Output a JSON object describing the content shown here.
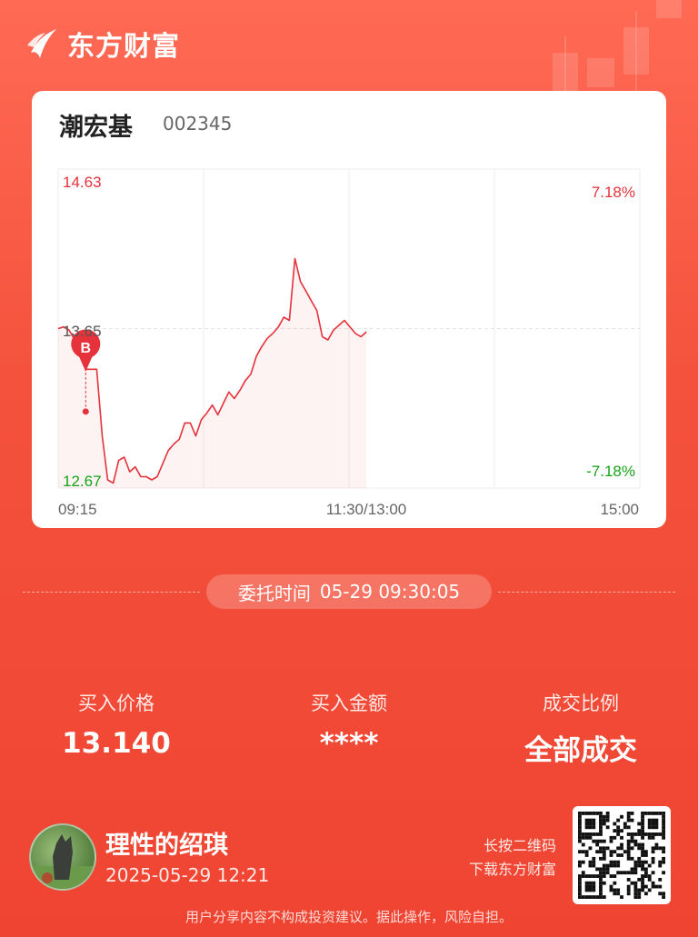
{
  "brand": {
    "name": "东方财富"
  },
  "stock": {
    "name": "潮宏基",
    "code": "002345"
  },
  "chart_data": {
    "type": "line",
    "price_high": "14.63",
    "price_mid": "13.65",
    "price_low": "12.67",
    "pct_high": "7.18%",
    "pct_low": "-7.18%",
    "ylim": [
      12.67,
      14.63
    ],
    "x_ticks": [
      "09:15",
      "11:30/13:00",
      "15:00"
    ],
    "buy_marker": "B",
    "series": [
      {
        "values": [
          13.65,
          13.66,
          13.64,
          13.58,
          13.48,
          13.4,
          13.4,
          13.4,
          12.99,
          12.72,
          12.7,
          12.84,
          12.86,
          12.77,
          12.8,
          12.74,
          12.74,
          12.72,
          12.74,
          12.82,
          12.9,
          12.94,
          12.97,
          13.07,
          13.07,
          12.99,
          13.09,
          13.13,
          13.18,
          13.12,
          13.19,
          13.26,
          13.22,
          13.27,
          13.33,
          13.37,
          13.48,
          13.54,
          13.59,
          13.62,
          13.66,
          13.72,
          13.7,
          14.08,
          13.94,
          13.88,
          13.82,
          13.76,
          13.6,
          13.58,
          13.64,
          13.67,
          13.7,
          13.66,
          13.62,
          13.6,
          13.63
        ]
      }
    ]
  },
  "order": {
    "label": "委托时间",
    "time": "05-29 09:30:05"
  },
  "stats": [
    {
      "label": "买入价格",
      "value": "13.140"
    },
    {
      "label": "买入金额",
      "value": "****"
    },
    {
      "label": "成交比例",
      "value": "全部成交"
    }
  ],
  "user": {
    "name": "理性的绍琪",
    "time": "2025-05-29 12:21"
  },
  "qr": {
    "line1": "长按二维码",
    "line2": "下载东方财富"
  },
  "disclaimer": "用户分享内容不构成投资建议。据此操作，风险自担。",
  "colors": {
    "up": "#e5323b",
    "down": "#17a317",
    "accent": "#f4523d"
  }
}
